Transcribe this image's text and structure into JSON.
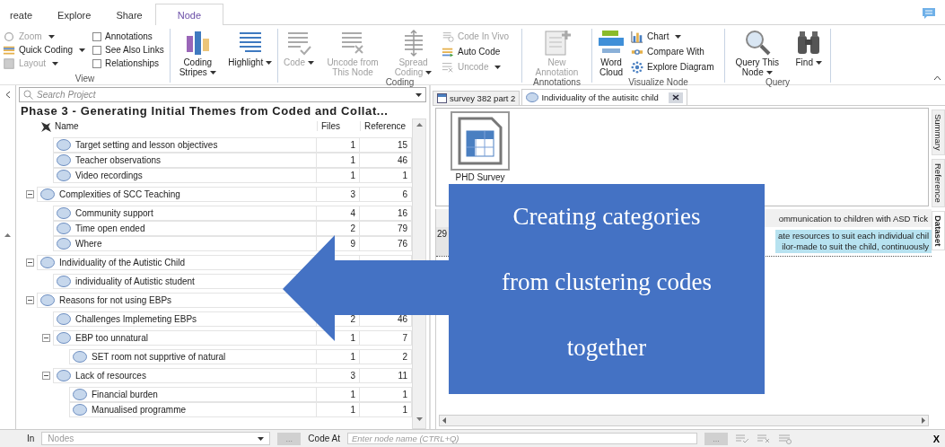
{
  "tabs": [
    {
      "label": "reate",
      "selected": false
    },
    {
      "label": "Explore",
      "selected": false
    },
    {
      "label": "Share",
      "selected": false
    },
    {
      "label": "Node",
      "selected": true
    }
  ],
  "ribbon": {
    "view": {
      "label": "View",
      "commands": [
        {
          "label": "Zoom",
          "disabled": true,
          "dropdown": true
        },
        {
          "label": "Quick Coding",
          "disabled": false,
          "dropdown": true
        },
        {
          "label": "Layout",
          "disabled": true,
          "dropdown": true
        }
      ],
      "toggles": [
        {
          "label": "Annotations",
          "checked": false
        },
        {
          "label": "See Also Links",
          "checked": false
        },
        {
          "label": "Relationships",
          "checked": false
        }
      ]
    },
    "display": {
      "commands": [
        {
          "label": "Coding Stripes",
          "disabled": false,
          "dropdown": true
        },
        {
          "label": "Highlight",
          "disabled": false,
          "dropdown": true
        }
      ]
    },
    "coding": {
      "label": "Coding",
      "large": [
        {
          "label": "Code",
          "disabled": true,
          "dropdown": true
        },
        {
          "label": "Uncode from This Node",
          "disabled": true,
          "dropdown": false
        },
        {
          "label": "Spread Coding",
          "disabled": true,
          "dropdown": true
        }
      ],
      "small": [
        {
          "label": "Code In Vivo",
          "disabled": true,
          "dropdown": false
        },
        {
          "label": "Auto Code",
          "disabled": false,
          "dropdown": false
        },
        {
          "label": "Uncode",
          "disabled": true,
          "dropdown": true
        }
      ]
    },
    "annotations": {
      "label": "Annotations",
      "commands": [
        {
          "label": "New Annotation",
          "disabled": true,
          "dropdown": false
        }
      ]
    },
    "visualize": {
      "label": "Visualize Node",
      "large": {
        "label": "Word Cloud",
        "disabled": false,
        "dropdown": false
      },
      "small": [
        {
          "label": "Chart",
          "disabled": false,
          "dropdown": true
        },
        {
          "label": "Compare With",
          "disabled": false,
          "dropdown": false
        },
        {
          "label": "Explore Diagram",
          "disabled": false,
          "dropdown": false
        }
      ]
    },
    "query": {
      "label": "Query",
      "commands": [
        {
          "label": "Query This Node",
          "disabled": false,
          "dropdown": true
        },
        {
          "label": "Find",
          "disabled": false,
          "dropdown": true
        }
      ]
    }
  },
  "navigator": {
    "search": {
      "placeholder": "Search Project"
    },
    "title": "Phase 3 - Generating Initial Themes from Coded and Collat...",
    "columns": [
      "Name",
      "Files",
      "Reference"
    ],
    "nodes": [
      {
        "children": [
          {
            "name": "Target setting and lesson objectives",
            "files": "1",
            "references": "15"
          },
          {
            "name": "Teacher observations",
            "files": "1",
            "references": "46"
          },
          {
            "name": "Video recordings",
            "files": "1",
            "references": "1"
          }
        ]
      },
      {
        "name": "Complexities of SCC Teaching",
        "files": "3",
        "references": "6",
        "expanded": true,
        "children": [
          {
            "name": "Community support",
            "files": "4",
            "references": "16"
          },
          {
            "name": "Time open ended",
            "files": "2",
            "references": "79"
          },
          {
            "name": "Where",
            "files": "9",
            "references": "76"
          }
        ]
      },
      {
        "name": "Individuality of the Autistic Child",
        "expanded": true,
        "children": [
          {
            "name": "individuality of Autistic student"
          }
        ]
      },
      {
        "name": "Reasons for not using EBPs",
        "expanded": true,
        "children": [
          {
            "name": "Challenges Implemeting EBPs",
            "files": "2",
            "references": "46"
          },
          {
            "name": "EBP too unnatural",
            "files": "1",
            "references": "7",
            "expanded": true,
            "children": [
              {
                "name": "SET room not supprtive of natural",
                "files": "1",
                "references": "2"
              }
            ]
          },
          {
            "name": "Lack of resources",
            "files": "3",
            "references": "11",
            "expanded": true,
            "children": [
              {
                "name": "Financial burden",
                "files": "1",
                "references": "1"
              },
              {
                "name": "Manualised programme",
                "files": "1",
                "references": "1"
              }
            ]
          }
        ]
      }
    ]
  },
  "detail": {
    "doc_tabs": [
      {
        "label": "survey 382 part 2",
        "selected": false
      },
      {
        "label": "Individuality of the autisitc child",
        "selected": true
      }
    ],
    "side_tabs": [
      {
        "label": "Summary",
        "selected": false
      },
      {
        "label": "Reference",
        "selected": false
      },
      {
        "label": "Dataset",
        "selected": true
      }
    ],
    "file": {
      "name": "PHD Survey"
    },
    "dataset": {
      "header": "ommunication to children with ASD Tick",
      "rows": [
        {
          "number": "29",
          "lines": [
            "ate resources to suit each individual chil",
            "ilor-made to suit the child, continuously"
          ]
        }
      ]
    }
  },
  "bottom_bar": {
    "scope_label": "In",
    "scope_value": "Nodes",
    "code_at_label": "Code At",
    "node_field": {
      "placeholder": "Enter node name (CTRL+Q)"
    },
    "browse_buttons": [
      "...",
      "..."
    ],
    "close": "X"
  },
  "callout": {
    "lines": [
      "Creating categories",
      "from clustering codes",
      "together"
    ]
  }
}
